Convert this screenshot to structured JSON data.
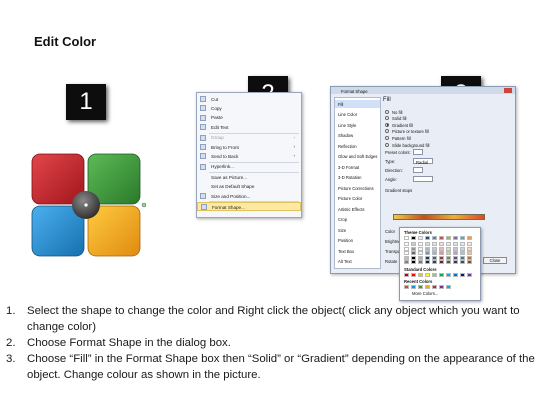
{
  "title": "Edit Color",
  "badges": [
    "1",
    "2",
    "3"
  ],
  "colors": {
    "tile_red": "#c8242a",
    "tile_green": "#3f9b3d",
    "tile_blue": "#1c8fd6",
    "tile_orange": "#f2a51c",
    "center": "#4a4a4a",
    "menu_highlight": "#fde9a3"
  },
  "context_menu": {
    "items": [
      {
        "label": "Cut",
        "icon": "scissors-icon",
        "disabled": false,
        "submenu": false
      },
      {
        "label": "Copy",
        "icon": "copy-icon",
        "disabled": false,
        "submenu": false
      },
      {
        "label": "Paste",
        "icon": "paste-icon",
        "disabled": false,
        "submenu": false
      },
      {
        "label": "Edit Text",
        "icon": "edit-text-icon",
        "disabled": false,
        "submenu": false
      },
      {
        "label": "Group",
        "icon": "group-icon",
        "disabled": true,
        "submenu": true
      },
      {
        "label": "Bring to Front",
        "icon": "bring-front-icon",
        "disabled": false,
        "submenu": true
      },
      {
        "label": "Send to Back",
        "icon": "send-back-icon",
        "disabled": false,
        "submenu": true
      },
      {
        "label": "Hyperlink...",
        "icon": "hyperlink-icon",
        "disabled": false,
        "submenu": false
      },
      {
        "label": "Save as Picture...",
        "icon": "",
        "disabled": false,
        "submenu": false
      },
      {
        "label": "Set as Default Shape",
        "icon": "",
        "disabled": false,
        "submenu": false
      },
      {
        "label": "Size and Position...",
        "icon": "size-icon",
        "disabled": false,
        "submenu": false
      },
      {
        "label": "Format Shape...",
        "icon": "format-shape-icon",
        "disabled": false,
        "submenu": false,
        "highlighted": true
      }
    ]
  },
  "format_dialog": {
    "title": "Format Shape",
    "categories": [
      "Fill",
      "Line Color",
      "Line Style",
      "Shadow",
      "Reflection",
      "Glow and Soft Edges",
      "3-D Format",
      "3-D Rotation",
      "Picture Corrections",
      "Picture Color",
      "Artistic Effects",
      "Crop",
      "Size",
      "Position",
      "Text Box",
      "Alt Text"
    ],
    "selected_category": "Fill",
    "pane_title": "Fill",
    "fill_options": [
      "No fill",
      "Solid fill",
      "Gradient fill",
      "Picture or texture fill",
      "Pattern fill",
      "Slide background fill"
    ],
    "selected_fill": "Gradient fill",
    "fields": [
      {
        "label": "Preset colors:",
        "value": ""
      },
      {
        "label": "Type:",
        "value": "Radial"
      },
      {
        "label": "Direction:",
        "value": ""
      },
      {
        "label": "Angle:",
        "value": ""
      }
    ],
    "gradient_stops_label": "Gradient stops",
    "color_label": "Color",
    "brightness_label": "Brightness",
    "transparency_label": "Transparency",
    "rotate_label": "Rotate",
    "close_label": "Close"
  },
  "color_picker": {
    "theme_colors_label": "Theme Colors",
    "standard_colors_label": "Standard Colors",
    "recent_colors_label": "Recent Colors",
    "more_colors_label": "More Colors...",
    "theme_top": [
      "#ffffff",
      "#000000",
      "#eeece1",
      "#1f497d",
      "#4f81bd",
      "#c0504d",
      "#9bbb59",
      "#8064a2",
      "#4bacc6",
      "#f79646"
    ],
    "standard": [
      "#c00000",
      "#ff0000",
      "#ffc000",
      "#ffff00",
      "#92d050",
      "#00b050",
      "#00b0f0",
      "#0070c0",
      "#002060",
      "#7030a0"
    ],
    "recent": [
      "#d24a2b",
      "#1c8fd6",
      "#3f9b3d",
      "#f2a51c",
      "#c8242a",
      "#7030a0",
      "#00b0f0"
    ]
  },
  "steps": [
    {
      "num": "1.",
      "text": "Select the shape to change the color and Right click the object( click any object which you want to change color)"
    },
    {
      "num": "2.",
      "text": "Choose Format Shape in the dialog box."
    },
    {
      "num": "3.",
      "text": "Choose “Fill” in the Format Shape box then “Solid” or “Gradient” depending on the appearance of the object. Change colour as shown in the picture."
    }
  ]
}
